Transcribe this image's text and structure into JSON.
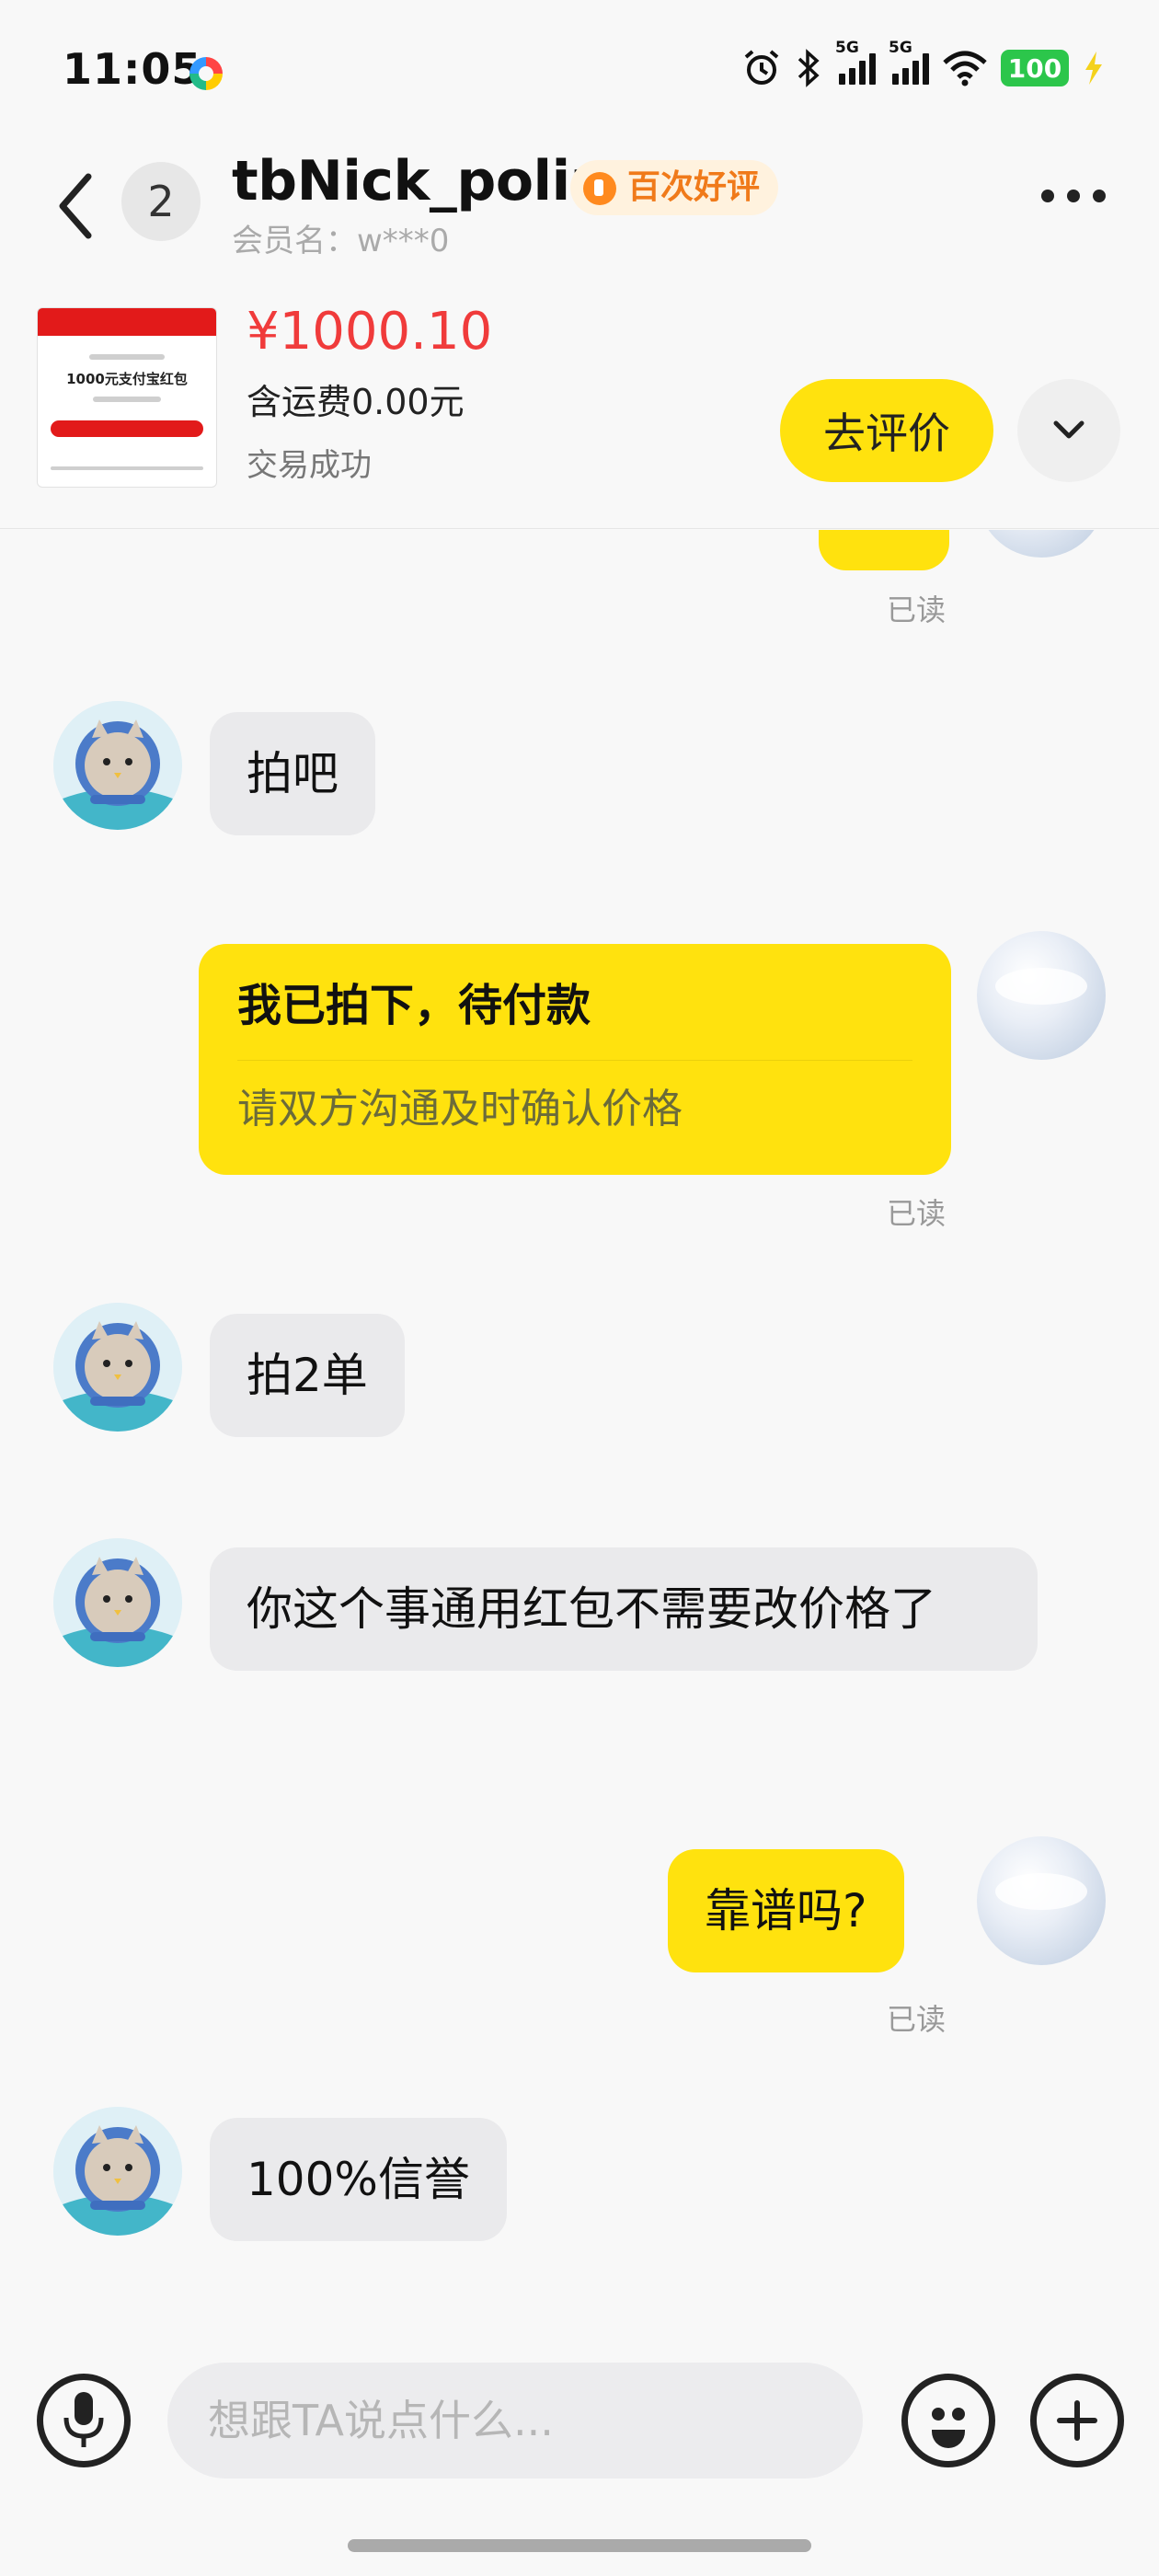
{
  "status_bar": {
    "time": "11:05",
    "net1": "5G",
    "net2": "5G",
    "battery": "100",
    "icons": [
      "app-icon",
      "alarm-icon",
      "bluetooth-icon",
      "signal-icon",
      "signal-icon",
      "wifi-icon",
      "battery-icon",
      "charging-icon"
    ]
  },
  "header": {
    "unread_count": "2",
    "nickname": "tbNick_polir",
    "praise_badge": "百次好评",
    "member_name": "会员名：w***0"
  },
  "order": {
    "product_title": "1000元支付宝红包",
    "price": "¥1000.10",
    "shipping": "含运费0.00元",
    "status": "交易成功",
    "review_button": "去评价"
  },
  "messages": [
    {
      "side": "out",
      "text": "",
      "read": "已读"
    },
    {
      "side": "in",
      "text": "拍吧"
    },
    {
      "side": "out",
      "type": "card",
      "title": "我已拍下，待付款",
      "subtitle": "请双方沟通及时确认价格",
      "read": "已读"
    },
    {
      "side": "in",
      "text": "拍2单"
    },
    {
      "side": "in",
      "text": "你这个事通用红包不需要改价格了"
    },
    {
      "side": "out",
      "text": "靠谱吗?",
      "read": "已读"
    },
    {
      "side": "in",
      "text": "100%信誉"
    }
  ],
  "input": {
    "placeholder": "想跟TA说点什么..."
  },
  "colors": {
    "accent_yellow": "#ffe20e",
    "price_red": "#f03b3b",
    "praise_orange": "#f07a1a",
    "battery_green": "#2cc64b"
  }
}
